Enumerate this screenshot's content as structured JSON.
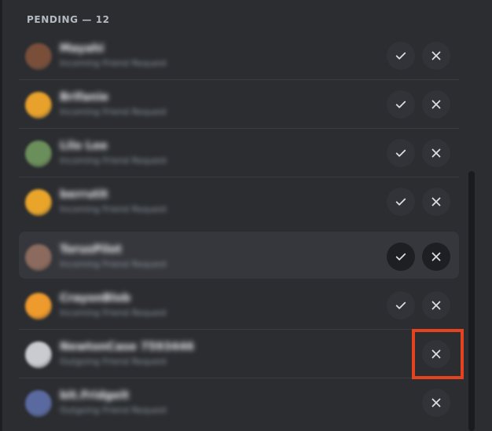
{
  "section": {
    "title": "PENDING — 12"
  },
  "requests": [
    {
      "name": "Mayahi",
      "subtitle": "Incoming Friend Request",
      "avatar_color": "#7a4f3a",
      "accept": true
    },
    {
      "name": "Brifanie",
      "subtitle": "Incoming Friend Request",
      "avatar_color": "#e8a12b",
      "accept": true
    },
    {
      "name": "Lilo Lee",
      "subtitle": "Incoming Friend Request",
      "avatar_color": "#6b8f5a",
      "accept": true
    },
    {
      "name": "berrutit",
      "subtitle": "Incoming Friend Request",
      "avatar_color": "#e9a52a",
      "accept": true
    },
    {
      "name": "TorusPilot",
      "subtitle": "Incoming Friend Request",
      "avatar_color": "#8c6a5e",
      "accept": true,
      "hover": true
    },
    {
      "name": "CrayonBlob",
      "subtitle": "Incoming Friend Request",
      "avatar_color": "#ee9a2c",
      "accept": true
    },
    {
      "name": "NewtonCase 7593446",
      "subtitle": "Outgoing Friend Request",
      "avatar_color": "#c9cbd1",
      "accept": false,
      "highlighted": true
    },
    {
      "name": "bit.Fridgeit",
      "subtitle": "Outgoing Friend Request",
      "avatar_color": "#5a6aa0",
      "accept": false
    }
  ],
  "icons": {
    "accept": "check-icon",
    "ignore": "close-icon"
  },
  "colors": {
    "highlight": "#e5431f",
    "background": "#2b2d31"
  }
}
